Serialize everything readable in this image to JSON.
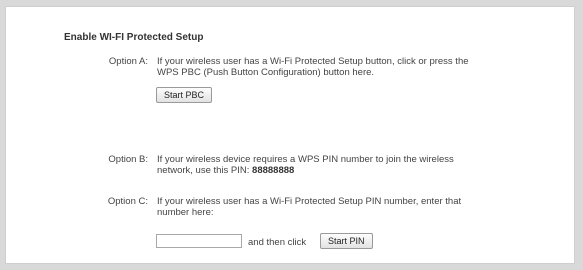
{
  "section_title": "Enable WI-FI Protected Setup",
  "option_a": {
    "label": "Option A:",
    "text_line1": "If your wireless user has a Wi-Fi Protected Setup button, click or press the",
    "text_line2": "WPS PBC (Push Button Configuration) button here.",
    "button_label": "Start PBC"
  },
  "option_b": {
    "label": "Option B:",
    "text_line1": "If your wireless device requires a WPS PIN number to join the wireless",
    "text_line2_prefix": "network, use this PIN: ",
    "pin": "88888888"
  },
  "option_c": {
    "label": "Option C:",
    "text_line1": "If your wireless user has a Wi-Fi Protected Setup PIN number, enter that",
    "text_line2": "number here:",
    "pin_input_value": "",
    "then_text": "and then click",
    "button_label": "Start PIN"
  }
}
